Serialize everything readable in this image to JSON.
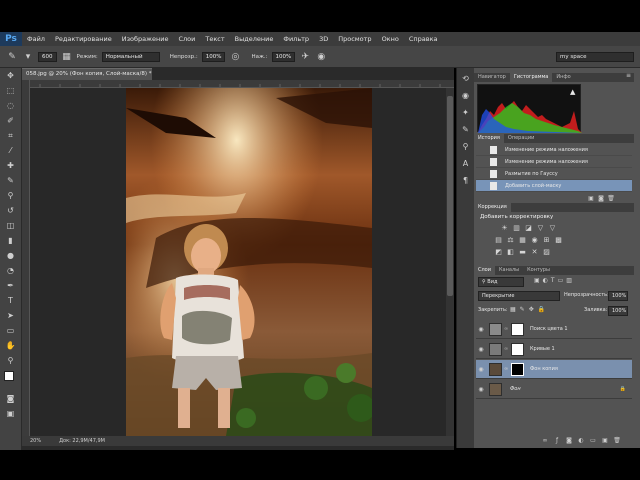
{
  "app": {
    "logo": "Ps"
  },
  "menu": [
    "Файл",
    "Редактирование",
    "Изображение",
    "Слои",
    "Текст",
    "Выделение",
    "Фильтр",
    "3D",
    "Просмотр",
    "Окно",
    "Справка"
  ],
  "options": {
    "brush_size": "600",
    "mode_label": "Режим:",
    "mode_value": "Нормальный",
    "opacity_label": "Непрозр.:",
    "opacity_value": "100%",
    "pressure_label": "Наж.:",
    "pressure_value": "100%",
    "workspace": "my space"
  },
  "document": {
    "tab_title": "058.jpg @ 20% (Фон копия, Слой-маска/8) *",
    "zoom": "20%",
    "doc_size": "Док: 22,9M/47,9M"
  },
  "histogram_panel": {
    "tabs": [
      "Навигатор",
      "Гистограмма",
      "Инфо"
    ],
    "active_tab": "Гистограмма"
  },
  "history_panel": {
    "tabs": [
      "История",
      "Операции"
    ],
    "items": [
      "Изменение режима наложения",
      "Изменение режима наложения",
      "Размытие по Гауссу",
      "Добавить слой-маску"
    ]
  },
  "adjustments_panel": {
    "tab": "Коррекция",
    "title": "Добавить корректировку",
    "icons_row1": [
      "☀",
      "▥",
      "◪",
      "▽",
      "▽"
    ],
    "icons_row2": [
      "▤",
      "⚖",
      "▦",
      "◉",
      "⊞",
      "▩"
    ],
    "icons_row3": [
      "◩",
      "◧",
      "▬",
      "✕",
      "▨"
    ]
  },
  "layers_panel": {
    "tabs": [
      "Слои",
      "Каналы",
      "Контуры"
    ],
    "filter_label": "Вид",
    "blend_mode": "Перекрытие",
    "opacity_label": "Непрозрачность:",
    "opacity_value": "100%",
    "lock_label": "Закрепить:",
    "fill_label": "Заливка:",
    "fill_value": "100%",
    "layers": [
      {
        "name": "Поиск цвета 1"
      },
      {
        "name": "Кривые 1"
      },
      {
        "name": "Фон копия"
      },
      {
        "name": "Фон"
      }
    ]
  },
  "colors": {
    "accent_selection": "#7a90ae",
    "panel_bg": "#535353",
    "app_bg": "#000000"
  }
}
